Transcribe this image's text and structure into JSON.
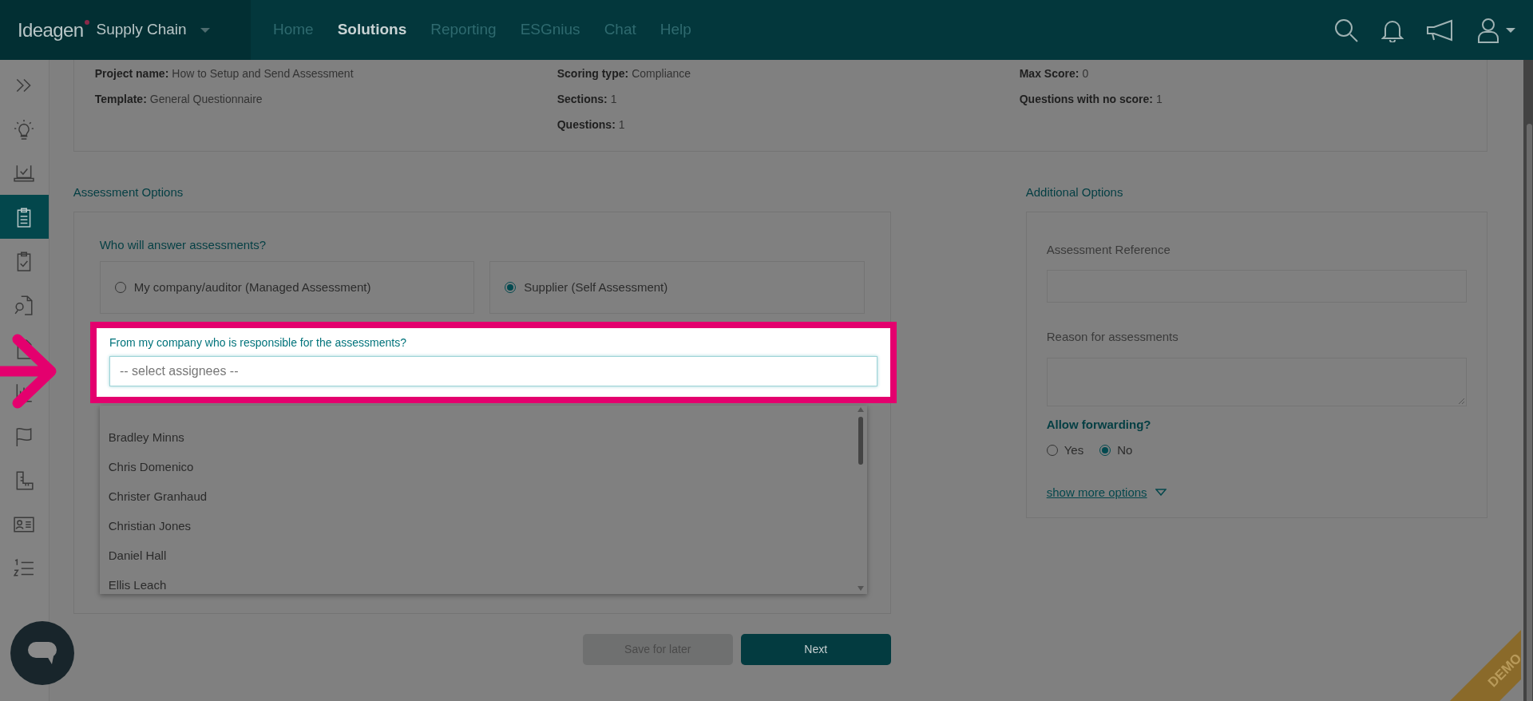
{
  "app": {
    "logo": "Ideagen",
    "product": "Supply Chain"
  },
  "nav": [
    {
      "label": "Home",
      "selected": false
    },
    {
      "label": "Solutions",
      "selected": true
    },
    {
      "label": "Reporting",
      "selected": false
    },
    {
      "label": "ESGnius",
      "selected": false
    },
    {
      "label": "Chat",
      "selected": false
    },
    {
      "label": "Help",
      "selected": false
    }
  ],
  "sidebar": [
    {
      "kind": "chevrons",
      "selected": false
    },
    {
      "kind": "bulb",
      "selected": false
    },
    {
      "kind": "laptop",
      "selected": false
    },
    {
      "kind": "clipboard",
      "selected": true
    },
    {
      "kind": "clipboard-check",
      "selected": false
    },
    {
      "kind": "doc-search",
      "selected": false
    },
    {
      "kind": "document",
      "selected": false
    },
    {
      "kind": "report",
      "selected": false
    },
    {
      "kind": "flag",
      "selected": false
    },
    {
      "kind": "ruler",
      "selected": false
    },
    {
      "kind": "id-card",
      "selected": false
    },
    {
      "kind": "numbered-list",
      "selected": false
    }
  ],
  "project_info": [
    [
      {
        "label": "Project name:",
        "value": "How to Setup and Send Assessment"
      },
      {
        "label": "Template:",
        "value": "General Questionnaire"
      }
    ],
    [
      {
        "label": "Scoring type:",
        "value": "Compliance"
      },
      {
        "label": "Sections:",
        "value": "1"
      },
      {
        "label": "Questions:",
        "value": "1"
      }
    ],
    [
      {
        "label": "Max Score:",
        "value": "0"
      },
      {
        "label": "Questions with no score:",
        "value": "1"
      }
    ]
  ],
  "assessment_options": {
    "title": "Assessment Options",
    "question": "Who will answer assessments?",
    "answerers": [
      {
        "label": "My company/auditor (Managed Assessment)",
        "selected": false
      },
      {
        "label": "Supplier (Self Assessment)",
        "selected": true
      }
    ],
    "responsible": {
      "label": "From my company who is responsible for the assessments?",
      "placeholder": "-- select assignees --",
      "options": [
        "Bradley Minns",
        "Chris Domenico",
        "Christer Granhaud",
        "Christian Jones",
        "Daniel Hall",
        "Ellis Leach"
      ]
    }
  },
  "additional_options": {
    "title": "Additional Options",
    "fields": [
      {
        "kind": "input",
        "label": "Assessment Reference"
      },
      {
        "kind": "textarea",
        "label": "Reason for assessments"
      }
    ],
    "forwarding": {
      "label": "Allow forwarding?",
      "options": [
        {
          "label": "Yes",
          "selected": false
        },
        {
          "label": "No",
          "selected": true
        }
      ]
    },
    "more_link": "show more options"
  },
  "buttons": [
    {
      "label": "Save for later",
      "disabled": true
    },
    {
      "label": "Next",
      "disabled": false
    }
  ],
  "ribbon": "DEMO"
}
